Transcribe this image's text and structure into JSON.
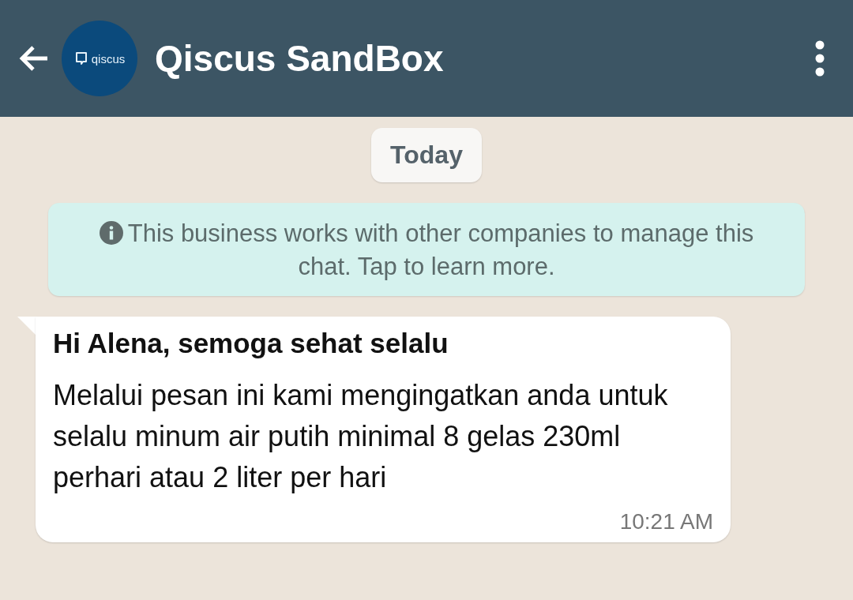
{
  "header": {
    "title": "Qiscus SandBox",
    "avatar_text": "qiscus"
  },
  "date_chip": "Today",
  "info_notice": "This business works with other companies to manage this chat. Tap to learn more.",
  "message": {
    "title": "Hi Alena, semoga sehat selalu",
    "body": "Melalui pesan ini kami mengingatkan anda untuk selalu minum air putih minimal 8 gelas 230ml perhari atau 2 liter per hari",
    "time": "10:21 AM"
  }
}
